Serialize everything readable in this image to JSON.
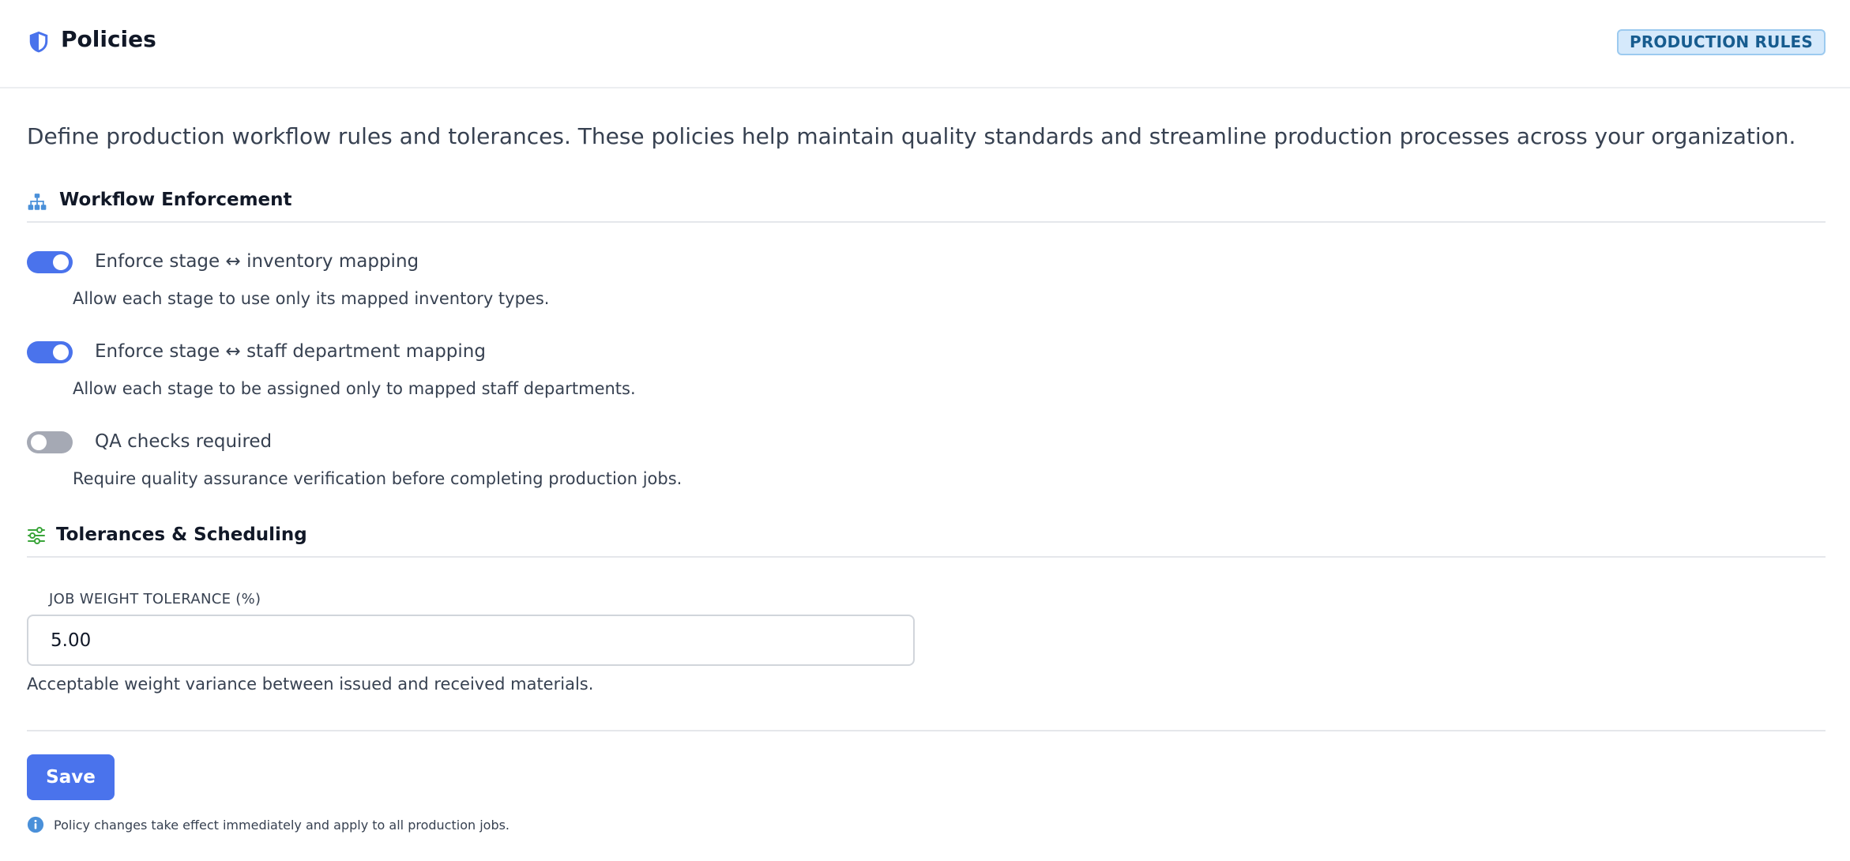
{
  "header": {
    "title": "Policies",
    "badge": "PRODUCTION RULES"
  },
  "intro": "Define production workflow rules and tolerances. These policies help maintain quality standards and streamline production processes across your organization.",
  "sections": {
    "workflow": {
      "title": "Workflow Enforcement",
      "icon": "sitemap-icon",
      "toggles": [
        {
          "label": "Enforce stage ↔ inventory mapping",
          "description": "Allow each stage to use only its mapped inventory types.",
          "enabled": true
        },
        {
          "label": "Enforce stage ↔ staff department mapping",
          "description": "Allow each stage to be assigned only to mapped staff departments.",
          "enabled": true
        },
        {
          "label": "QA checks required",
          "description": "Require quality assurance verification before completing production jobs.",
          "enabled": false
        }
      ]
    },
    "tolerances": {
      "title": "Tolerances & Scheduling",
      "icon": "sliders-icon",
      "field_label": "JOB WEIGHT TOLERANCE (%)",
      "field_value": "5.00",
      "field_help": "Acceptable weight variance between issued and received materials."
    }
  },
  "actions": {
    "save_label": "Save",
    "note": "Policy changes take effect immediately and apply to all production jobs."
  },
  "colors": {
    "accent": "#4a73ec",
    "toggle_off": "#a5a9b4",
    "badge_bg": "#d5e9fb",
    "badge_text": "#175c8f",
    "workflow_icon": "#4a90d9",
    "tolerance_icon": "#3aa53a"
  }
}
